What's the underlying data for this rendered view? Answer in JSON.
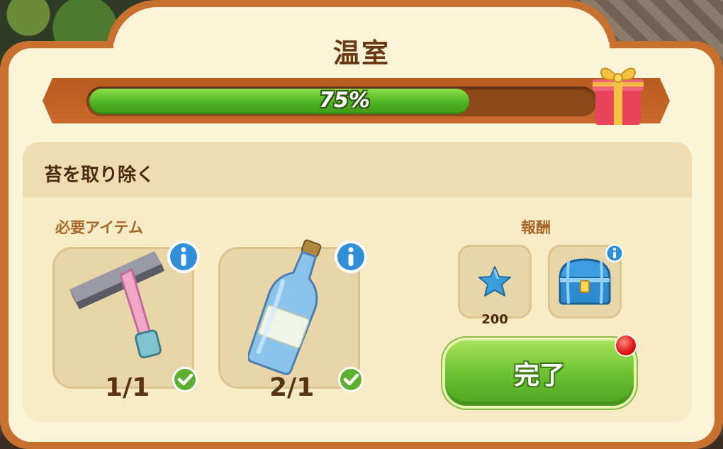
{
  "title": "温室",
  "progress": {
    "percent": 75,
    "label": "75%"
  },
  "task": {
    "title": "苔を取り除く"
  },
  "required": {
    "label": "必要アイテム",
    "items": [
      {
        "icon": "squeegee-icon",
        "count": "1/1",
        "complete": true
      },
      {
        "icon": "aqua-bottle-icon",
        "count": "2/1",
        "complete": true
      }
    ]
  },
  "rewards": {
    "label": "報酬",
    "items": [
      {
        "icon": "blue-star-icon",
        "amount": "200"
      },
      {
        "icon": "blue-chest-icon"
      }
    ]
  },
  "complete_button": {
    "label": "完了",
    "has_notification": true
  },
  "colors": {
    "frame": "#c8702e",
    "panel": "#fbf4d8",
    "progress_fill": "#4fb323",
    "button": "#6cc233",
    "title_text": "#6a3a14"
  }
}
